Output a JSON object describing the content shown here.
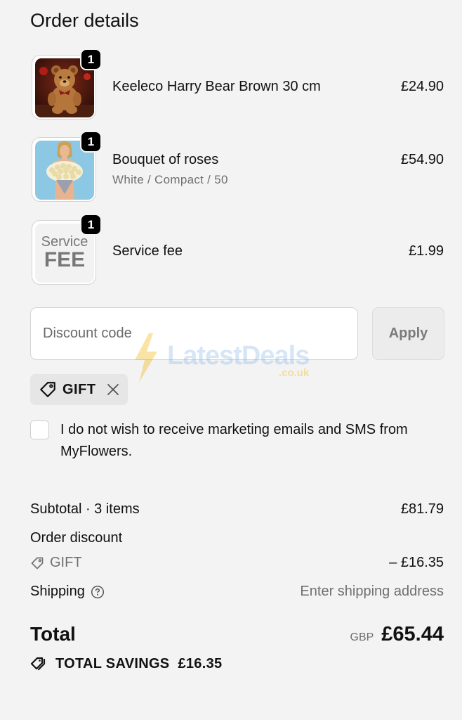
{
  "header": {
    "title": "Order details"
  },
  "items": [
    {
      "quantity": "1",
      "name": "Keeleco Harry Bear Brown 30 cm",
      "variant": "",
      "price": "£24.90",
      "thumbnail": "teddy-bear-photo"
    },
    {
      "quantity": "1",
      "name": "Bouquet of roses",
      "variant": "White / Compact / 50",
      "price": "£54.90",
      "thumbnail": "roses-bouquet-photo"
    },
    {
      "quantity": "1",
      "name": "Service fee",
      "variant": "",
      "price": "£1.99",
      "thumbnail": "service-fee-graphic",
      "thumb_text_top": "Service",
      "thumb_text_bottom": "FEE"
    }
  ],
  "discount": {
    "placeholder": "Discount code",
    "value": "",
    "apply_label": "Apply",
    "applied_code": "GIFT"
  },
  "marketing": {
    "checked": false,
    "text": "I do not wish to receive marketing emails and SMS from MyFlowers."
  },
  "summary": {
    "subtotal_label": "Subtotal · 3 items",
    "subtotal_value": "£81.79",
    "order_discount_label": "Order discount",
    "discount_code": "GIFT",
    "discount_value": "– £16.35",
    "shipping_label": "Shipping",
    "shipping_value": "Enter shipping address",
    "total_label": "Total",
    "currency": "GBP",
    "total_value": "£65.44",
    "savings_label": "TOTAL SAVINGS",
    "savings_value": "£16.35"
  },
  "watermark": {
    "text": "LatestDeals",
    "sub": ".co.uk"
  },
  "colors": {
    "background": "#f3f3f3",
    "badge": "#000000",
    "text": "#111111",
    "muted": "#707070",
    "watermark_blue": "#8fb8e8",
    "watermark_yellow": "#f0b400"
  }
}
